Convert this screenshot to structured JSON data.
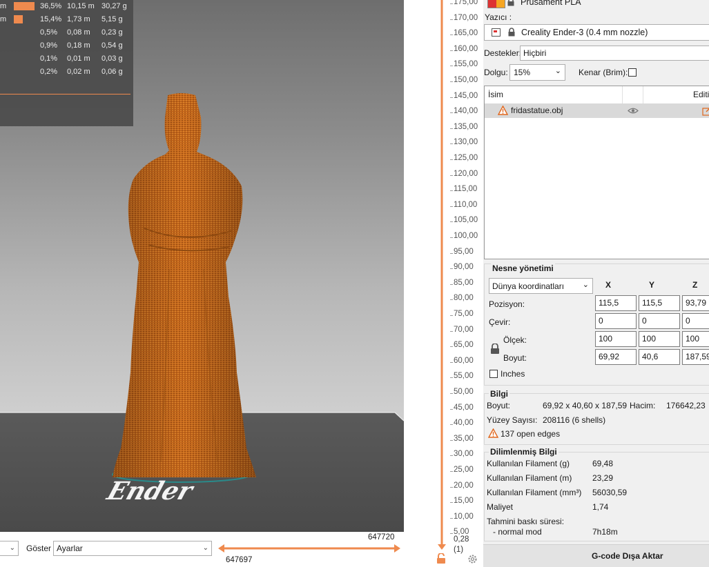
{
  "stats_rows": [
    {
      "label": "m",
      "percent": "36,5%",
      "length": "10,15 m",
      "weight": "30,27 g",
      "bar": 0.365
    },
    {
      "label": "m",
      "percent": "15,4%",
      "length": "1,73 m",
      "weight": "5,15 g",
      "bar": 0.154
    },
    {
      "label": "",
      "percent": "0,5%",
      "length": "0,08 m",
      "weight": "0,23 g",
      "bar": 0
    },
    {
      "label": "",
      "percent": "0,9%",
      "length": "0,18 m",
      "weight": "0,54 g",
      "bar": 0
    },
    {
      "label": "",
      "percent": "0,1%",
      "length": "0,01 m",
      "weight": "0,03 g",
      "bar": 0
    },
    {
      "label": "",
      "percent": "0,2%",
      "length": "0,02 m",
      "weight": "0,06 g",
      "bar": 0
    }
  ],
  "viewport": {
    "bed_logo_text": "Ender"
  },
  "bottom_bar": {
    "show_label": "Göster",
    "show_value": "Ayarlar",
    "range_top": "647720",
    "range_bottom": "647697"
  },
  "layer_slider": {
    "ticks": [
      "175,00",
      "170,00",
      "165,00",
      "160,00",
      "155,00",
      "150,00",
      "145,00",
      "140,00",
      "135,00",
      "130,00",
      "125,00",
      "120,00",
      "115,00",
      "110,00",
      "105,00",
      "100,00",
      "95,00",
      "90,00",
      "85,00",
      "80,00",
      "75,00",
      "70,00",
      "65,00",
      "60,00",
      "55,00",
      "50,00",
      "45,00",
      "40,00",
      "35,00",
      "30,00",
      "25,00",
      "20,00",
      "15,00",
      "10,00",
      "5,00"
    ],
    "bottom_value": "0,28",
    "bottom_layer": "(1)"
  },
  "panel": {
    "filament": "Prusament PLA",
    "printer_label": "Yazıcı :",
    "printer_value": "Creality Ender-3 (0.4 mm nozzle)",
    "supports_label": "Destekler:",
    "supports_value": "Hiçbiri",
    "infill_label": "Dolgu:",
    "infill_value": "15%",
    "brim_label": "Kenar (Brim):",
    "list_col_name": "İsim",
    "list_col_edit": "Editi",
    "object_name": "fridastatue.obj",
    "manip": {
      "title": "Nesne yönetimi",
      "coord_mode": "Dünya koordinatları",
      "x_header": "X",
      "y_header": "Y",
      "z_header": "Z",
      "position_label": "Pozisyon:",
      "position": [
        "115,5",
        "115,5",
        "93,79"
      ],
      "rotate_label": "Çevir:",
      "rotate": [
        "0",
        "0",
        "0"
      ],
      "scale_label": "Ölçek:",
      "scale": [
        "100",
        "100",
        "100"
      ],
      "size_label": "Boyut:",
      "size": [
        "69,92",
        "40,6",
        "187,59"
      ],
      "inches_label": "Inches"
    },
    "info": {
      "title": "Bilgi",
      "size_label": "Boyut:",
      "size_value": "69,92 x 40,60 x 187,59",
      "volume_label": "Hacim:",
      "volume_value": "176642,23",
      "facets_label": "Yüzey Sayısı:",
      "facets_value": "208116 (6 shells)",
      "warning": "137 open edges"
    },
    "sliced": {
      "title": "Dilimlenmiş Bilgi",
      "rows": [
        {
          "label": "Kullanılan Filament (g)",
          "value": "69,48"
        },
        {
          "label": "Kullanılan Filament (m)",
          "value": "23,29"
        },
        {
          "label": "Kullanılan Filament (mm³)",
          "value": "56030,59"
        },
        {
          "label": "Maliyet",
          "value": "1,74"
        }
      ],
      "time_label": "Tahmini baskı süresi:",
      "mode_label": "- normal mod",
      "mode_value": "7h18m"
    },
    "export_button": "G-code Dışa Aktar"
  },
  "colors": {
    "accent": "#ef8a4e",
    "model": "#c8681c",
    "panel_bg": "#f0f0f0"
  }
}
